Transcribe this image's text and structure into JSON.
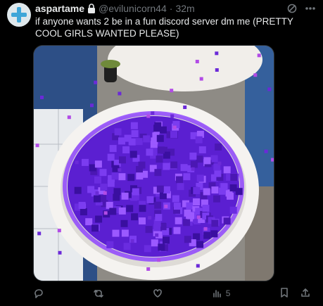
{
  "post": {
    "display_name": "aspartame",
    "handle": "@evilunicorn44",
    "separator": "·",
    "time": "32m",
    "text": "if anyone wants 2 be in a fun discord server dm me (PRETTY COOL GIRLS WANTED PLEASE)",
    "media_icon": "toilet-purple-portal-image",
    "views_count": "5"
  },
  "icons": {
    "avatar": "medical-cross-avatar",
    "lock": "lock-icon",
    "grok": "grok-icon",
    "more": "more-icon",
    "reply": "reply-icon",
    "retweet": "retweet-icon",
    "like": "like-icon",
    "views": "views-icon",
    "bookmark": "bookmark-icon",
    "share": "share-icon"
  },
  "colors": {
    "background": "#000000",
    "text": "#e7e9ea",
    "muted": "#71767b",
    "portal": "#5b1fd1"
  }
}
